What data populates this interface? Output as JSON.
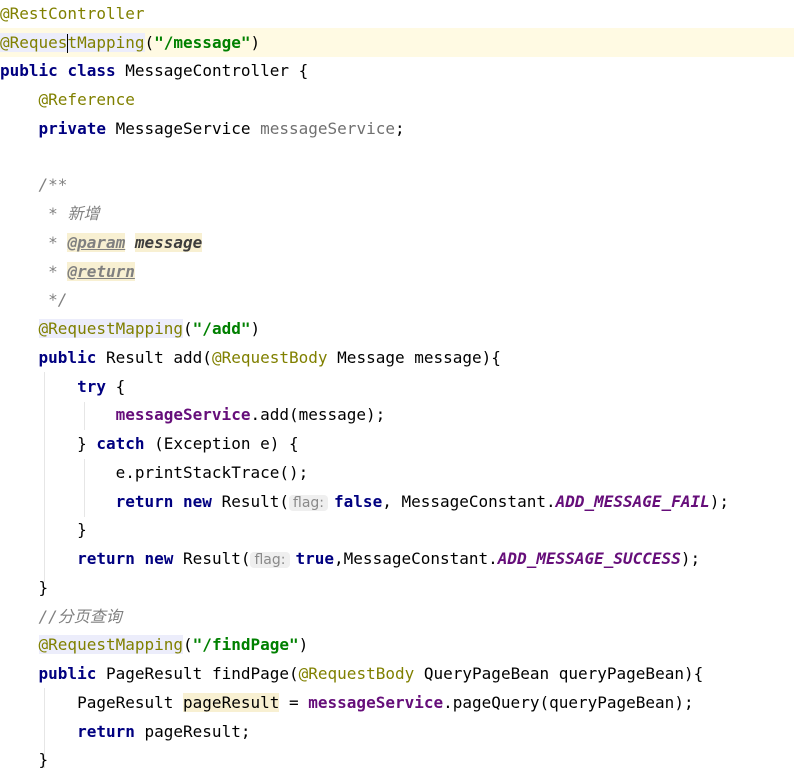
{
  "editor": {
    "language": "Java",
    "file_class": "MessageController",
    "tokens": {
      "ann_rest": "@RestController",
      "ann_rm_a": "@Reques",
      "ann_rm_b": "tMapping",
      "path_message": "\"/message\"",
      "kw_public": "public",
      "kw_class": "class",
      "class_name": "MessageController {",
      "ann_reference": "@Reference",
      "kw_private": "private",
      "type_service": "MessageService",
      "field_service_gray": "messageService",
      "semicolon": ";",
      "doc_open": "/**",
      "doc_star": " * ",
      "doc_text_add": "新增",
      "doc_param": "@param",
      "doc_param_name": "message",
      "doc_return": "@return",
      "doc_close": " */",
      "ann_request_mapping": "@RequestMapping",
      "paren_open": "(",
      "paren_close": ")",
      "path_add": "\"/add\"",
      "type_result": "Result",
      "method_add": "add(",
      "ann_request_body": "@RequestBody",
      "add_params": "Message message){",
      "kw_try": "try",
      "brace_open": "{",
      "brace_close": "}",
      "field_service": "messageService",
      "call_add": ".add(message);",
      "kw_catch": "catch",
      "catch_params": "(Exception e) {",
      "print_trace": "e.printStackTrace();",
      "kw_return": "return",
      "kw_new": "new",
      "result_call": "Result(",
      "hint_flag": "flag:",
      "kw_false": "false",
      "kw_true": "true",
      "msg_constant_sp": ", MessageConstant.",
      "msg_constant": ",MessageConstant.",
      "const_fail": "ADD_MESSAGE_FAIL",
      "const_success": "ADD_MESSAGE_SUCCESS",
      "close_stmt": ");",
      "comment_page": "//分页查询",
      "path_findpage": "\"/findPage\"",
      "type_page_result": "PageResult",
      "method_findpage": "findPage(",
      "findpage_params": "QueryPageBean queryPageBean){",
      "var_page_result": "pageResult",
      "assign": " = ",
      "call_page_query": ".pageQuery(queryPageBean);",
      "return_value": "pageResult;"
    }
  }
}
